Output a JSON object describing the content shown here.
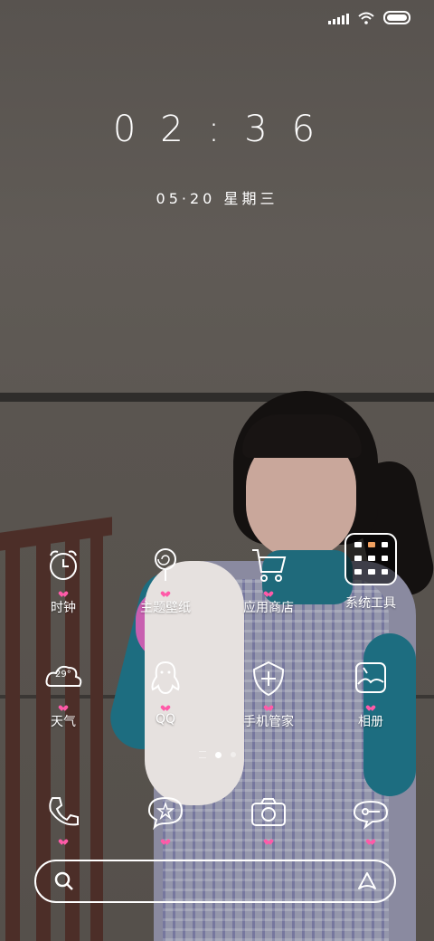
{
  "status_bar": {
    "signal_icon": "signal-bars-icon",
    "wifi_icon": "wifi-icon",
    "battery_icon": "battery-icon"
  },
  "lock": {
    "time": "02:36",
    "date": "05·20 星期三"
  },
  "apps": [
    {
      "label": "时钟",
      "icon": "alarm-clock-icon"
    },
    {
      "label": "主题壁纸",
      "icon": "lollipop-icon"
    },
    {
      "label": "应用商店",
      "icon": "shopping-cart-icon"
    },
    {
      "label": "系统工具",
      "icon": "tools-folder-icon"
    },
    {
      "label": "天气",
      "icon": "weather-cloud-icon",
      "temp": "29°"
    },
    {
      "label": "QQ",
      "icon": "penguin-icon"
    },
    {
      "label": "手机管家",
      "icon": "shield-plus-icon"
    },
    {
      "label": "相册",
      "icon": "gallery-icon"
    }
  ],
  "dock": [
    {
      "icon": "phone-icon"
    },
    {
      "icon": "message-star-icon"
    },
    {
      "icon": "camera-icon"
    },
    {
      "icon": "browser-bubble-icon"
    }
  ],
  "pager": {
    "pages": 2,
    "active": 1
  },
  "search": {
    "left_icon": "search-icon",
    "right_icon": "assistant-icon"
  }
}
